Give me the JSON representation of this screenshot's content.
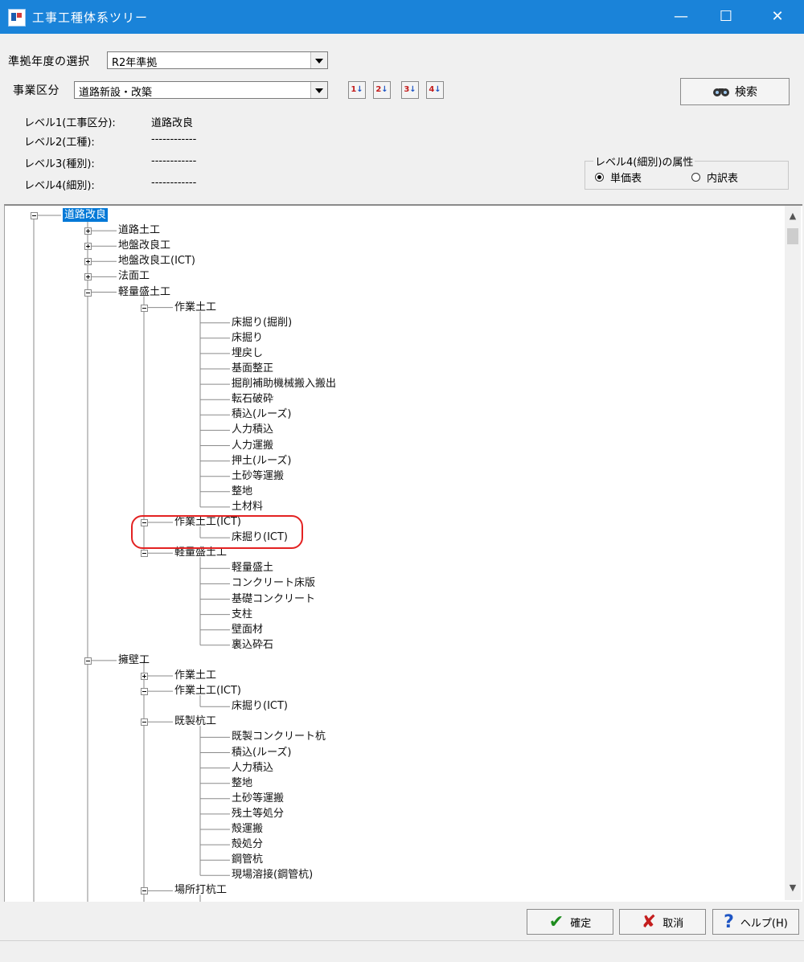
{
  "window": {
    "title": "工事工種体系ツリー",
    "minimize_glyph": "—",
    "maximize_glyph": "☐",
    "close_glyph": "✕"
  },
  "form": {
    "year_label": "準拠年度の選択",
    "year_value": "R2年準拠",
    "category_label": "事業区分",
    "category_value": "道路新設・改築",
    "sort_buttons": [
      "1",
      "2",
      "3",
      "4"
    ],
    "search_label": "検索"
  },
  "levels": [
    {
      "label": "レベル1(工事区分):",
      "value": "道路改良"
    },
    {
      "label": "レベル2(工種):",
      "value": "------------"
    },
    {
      "label": "レベル3(種別):",
      "value": "------------"
    },
    {
      "label": "レベル4(細別):",
      "value": "------------"
    }
  ],
  "attribute": {
    "legend": "レベル4(細別)の属性",
    "options": [
      "単価表",
      "内訳表"
    ],
    "selected": "単価表"
  },
  "tree": [
    {
      "text": "道路改良",
      "level": 0,
      "exp": "minus",
      "selected": true
    },
    {
      "text": "道路土工",
      "level": 1,
      "exp": "plus"
    },
    {
      "text": "地盤改良工",
      "level": 1,
      "exp": "plus"
    },
    {
      "text": "地盤改良工(ICT)",
      "level": 1,
      "exp": "plus"
    },
    {
      "text": "法面工",
      "level": 1,
      "exp": "plus"
    },
    {
      "text": "軽量盛土工",
      "level": 1,
      "exp": "minus"
    },
    {
      "text": "作業土工",
      "level": 2,
      "exp": "minus"
    },
    {
      "text": "床掘り(掘削)",
      "level": 3
    },
    {
      "text": "床掘り",
      "level": 3
    },
    {
      "text": "埋戻し",
      "level": 3
    },
    {
      "text": "基面整正",
      "level": 3
    },
    {
      "text": "掘削補助機械搬入搬出",
      "level": 3
    },
    {
      "text": "転石破砕",
      "level": 3
    },
    {
      "text": "積込(ルーズ)",
      "level": 3
    },
    {
      "text": "人力積込",
      "level": 3
    },
    {
      "text": "人力運搬",
      "level": 3
    },
    {
      "text": "押土(ルーズ)",
      "level": 3
    },
    {
      "text": "土砂等運搬",
      "level": 3
    },
    {
      "text": "整地",
      "level": 3
    },
    {
      "text": "土材料",
      "level": 3
    },
    {
      "text": "作業土工(ICT)",
      "level": 2,
      "exp": "minus"
    },
    {
      "text": "床掘り(ICT)",
      "level": 3
    },
    {
      "text": "軽量盛土工",
      "level": 2,
      "exp": "minus"
    },
    {
      "text": "軽量盛土",
      "level": 3
    },
    {
      "text": "コンクリート床版",
      "level": 3
    },
    {
      "text": "基礎コンクリート",
      "level": 3
    },
    {
      "text": "支柱",
      "level": 3
    },
    {
      "text": "壁面材",
      "level": 3
    },
    {
      "text": "裏込砕石",
      "level": 3
    },
    {
      "text": "擁壁工",
      "level": 1,
      "exp": "minus"
    },
    {
      "text": "作業土工",
      "level": 2,
      "exp": "plus"
    },
    {
      "text": "作業土工(ICT)",
      "level": 2,
      "exp": "minus"
    },
    {
      "text": "床掘り(ICT)",
      "level": 3
    },
    {
      "text": "既製杭工",
      "level": 2,
      "exp": "minus"
    },
    {
      "text": "既製コンクリート杭",
      "level": 3
    },
    {
      "text": "積込(ルーズ)",
      "level": 3
    },
    {
      "text": "人力積込",
      "level": 3
    },
    {
      "text": "整地",
      "level": 3
    },
    {
      "text": "土砂等運搬",
      "level": 3
    },
    {
      "text": "残土等処分",
      "level": 3
    },
    {
      "text": "殻運搬",
      "level": 3
    },
    {
      "text": "殻処分",
      "level": 3
    },
    {
      "text": "鋼管杭",
      "level": 3
    },
    {
      "text": "現場溶接(鋼管杭)",
      "level": 3
    },
    {
      "text": "場所打杭工",
      "level": 2,
      "exp": "minus"
    }
  ],
  "buttons": {
    "ok": "確定",
    "cancel": "取消",
    "help": "ヘルプ(H)"
  },
  "icons": {
    "search": "binoculars-icon",
    "ok": "check-icon",
    "cancel": "x-icon",
    "help": "question-icon"
  },
  "colors": {
    "titlebar": "#1a83d9",
    "selection": "#0078d7",
    "highlight": "#e32222"
  }
}
